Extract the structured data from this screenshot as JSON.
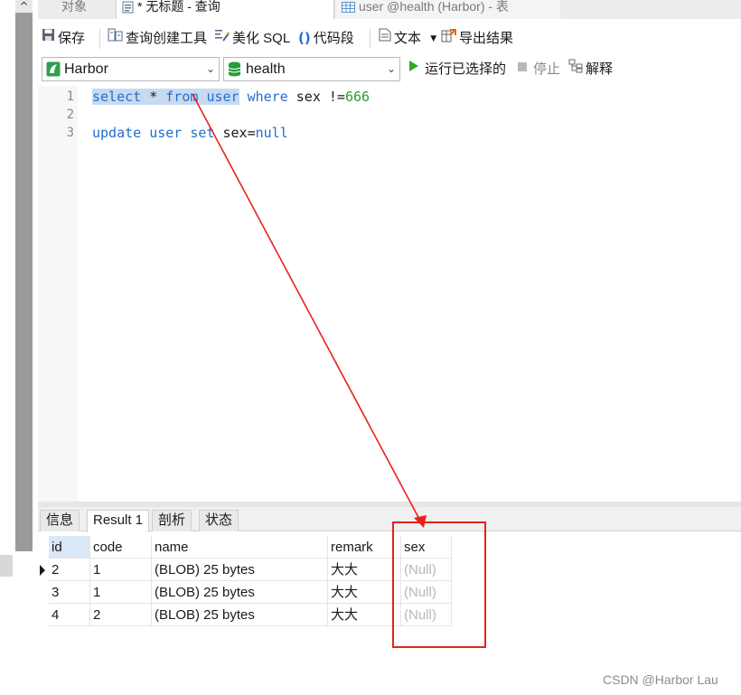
{
  "tabs": [
    {
      "label": "对象"
    },
    {
      "label": "* 无标题 - 查询"
    },
    {
      "label": "user @health (Harbor) - 表"
    }
  ],
  "toolbar": {
    "save": "保存",
    "query_builder": "查询创建工具",
    "beautify_sql": "美化 SQL",
    "code_snippet": "代码段",
    "text": "文本",
    "export_results": "导出结果"
  },
  "selectors": {
    "connection": "Harbor",
    "database": "health",
    "run_selected": "运行已选择的",
    "stop": "停止",
    "explain": "解释"
  },
  "editor": {
    "line_numbers": [
      "1",
      "2",
      "3"
    ],
    "line1": {
      "k1": "select",
      "star": " * ",
      "k2": "from",
      "sp": " ",
      "k3": "user",
      "sp2": " ",
      "k4": "where",
      "rest": " sex !=",
      "num": "666"
    },
    "line3": {
      "k1": "update",
      "sp": " ",
      "k2": "user",
      "sp2": " ",
      "k3": "set",
      "rest": " sex=",
      "k4": "null"
    }
  },
  "result_tabs": [
    "信息",
    "Result 1",
    "剖析",
    "状态"
  ],
  "grid": {
    "columns": [
      "id",
      "code",
      "name",
      "remark",
      "sex"
    ],
    "rows": [
      [
        "2",
        "1",
        "(BLOB) 25 bytes",
        "大大",
        "(Null)"
      ],
      [
        "3",
        "1",
        "(BLOB) 25 bytes",
        "大大",
        "(Null)"
      ],
      [
        "4",
        "2",
        "(BLOB) 25 bytes",
        "大大",
        "(Null)"
      ]
    ]
  },
  "colors": {
    "keyword": "#1f6fd1",
    "number": "#2aa02a",
    "annotation": "#e8211b",
    "run_icon": "#2eaa2e"
  },
  "watermark": "CSDN @Harbor Lau"
}
